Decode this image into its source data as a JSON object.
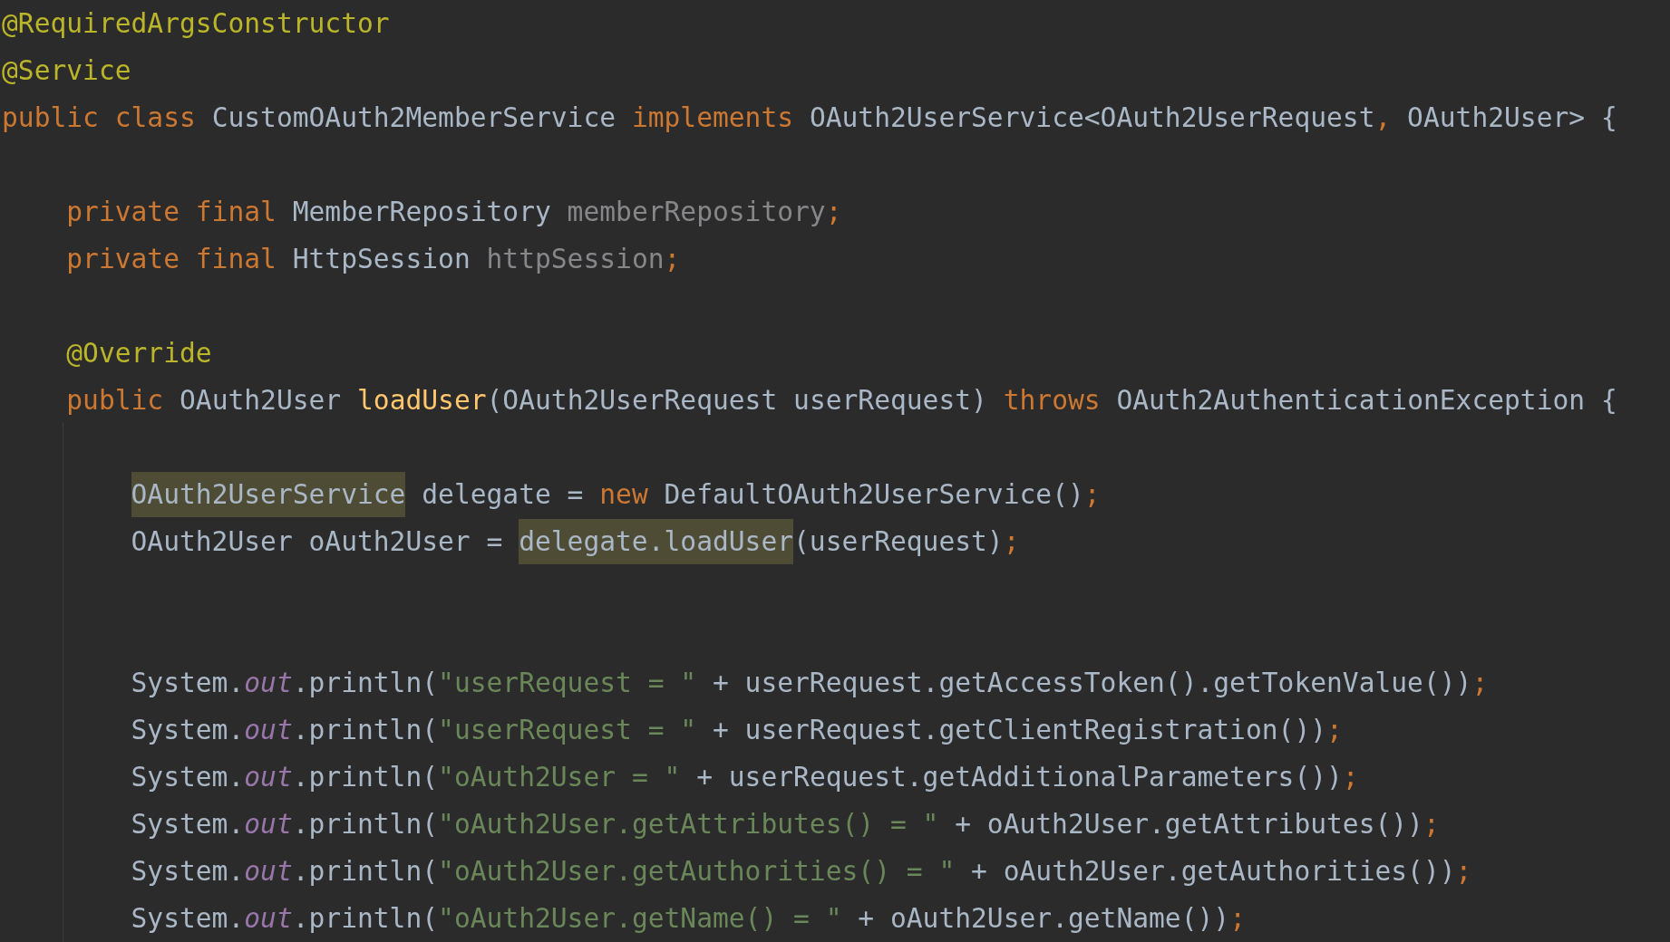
{
  "editor": {
    "lines": [
      {
        "kind": "code",
        "tokens": [
          {
            "text": "@RequiredArgsConstructor",
            "kind": "annotation"
          }
        ]
      },
      {
        "kind": "code",
        "tokens": [
          {
            "text": "@Service",
            "kind": "annotation"
          }
        ]
      },
      {
        "kind": "code",
        "tokens": [
          {
            "text": "public class ",
            "kind": "keyword"
          },
          {
            "text": "CustomOAuth2MemberService ",
            "kind": "plain"
          },
          {
            "text": "implements ",
            "kind": "keyword"
          },
          {
            "text": "OAuth2UserService<OAuth2UserRequest",
            "kind": "plain"
          },
          {
            "text": ",",
            "kind": "keyword"
          },
          {
            "text": " OAuth2User> {",
            "kind": "plain"
          }
        ]
      },
      {
        "kind": "blank"
      },
      {
        "kind": "code",
        "tokens": [
          {
            "text": "    private final ",
            "kind": "keyword"
          },
          {
            "text": "MemberRepository ",
            "kind": "plain"
          },
          {
            "text": "memberRepository",
            "kind": "field"
          },
          {
            "text": ";",
            "kind": "keyword"
          }
        ]
      },
      {
        "kind": "code",
        "tokens": [
          {
            "text": "    private final ",
            "kind": "keyword"
          },
          {
            "text": "HttpSession ",
            "kind": "plain"
          },
          {
            "text": "httpSession",
            "kind": "field"
          },
          {
            "text": ";",
            "kind": "keyword"
          }
        ]
      },
      {
        "kind": "blank"
      },
      {
        "kind": "code",
        "tokens": [
          {
            "text": "    @Override",
            "kind": "annotation"
          }
        ]
      },
      {
        "kind": "code",
        "tokens": [
          {
            "text": "    public ",
            "kind": "keyword"
          },
          {
            "text": "OAuth2User ",
            "kind": "plain"
          },
          {
            "text": "loadUser",
            "kind": "method"
          },
          {
            "text": "(OAuth2UserRequest userRequest) ",
            "kind": "plain"
          },
          {
            "text": "throws ",
            "kind": "keyword"
          },
          {
            "text": "OAuth2AuthenticationException {",
            "kind": "plain"
          }
        ]
      },
      {
        "kind": "blank"
      },
      {
        "kind": "code",
        "tokens": [
          {
            "text": "        OAuth2UserService",
            "kind": "highlight"
          },
          {
            "text": " delegate = ",
            "kind": "plain"
          },
          {
            "text": "new ",
            "kind": "keyword"
          },
          {
            "text": "DefaultOAuth2UserService()",
            "kind": "plain"
          },
          {
            "text": ";",
            "kind": "keyword"
          }
        ]
      },
      {
        "kind": "code",
        "tokens": [
          {
            "text": "        OAuth2User oAuth2User = ",
            "kind": "plain"
          },
          {
            "text": "delegate.loadUser",
            "kind": "highlight"
          },
          {
            "text": "(userRequest)",
            "kind": "plain"
          },
          {
            "text": ";",
            "kind": "keyword"
          }
        ]
      },
      {
        "kind": "blank"
      },
      {
        "kind": "blank"
      },
      {
        "kind": "code",
        "tokens": [
          {
            "text": "        System.",
            "kind": "plain"
          },
          {
            "text": "out",
            "kind": "static"
          },
          {
            "text": ".println(",
            "kind": "plain"
          },
          {
            "text": "\"userRequest = \"",
            "kind": "string"
          },
          {
            "text": " + userRequest.getAccessToken().getTokenValue())",
            "kind": "plain"
          },
          {
            "text": ";",
            "kind": "keyword"
          }
        ]
      },
      {
        "kind": "code",
        "tokens": [
          {
            "text": "        System.",
            "kind": "plain"
          },
          {
            "text": "out",
            "kind": "static"
          },
          {
            "text": ".println(",
            "kind": "plain"
          },
          {
            "text": "\"userRequest = \"",
            "kind": "string"
          },
          {
            "text": " + userRequest.getClientRegistration())",
            "kind": "plain"
          },
          {
            "text": ";",
            "kind": "keyword"
          }
        ]
      },
      {
        "kind": "code",
        "tokens": [
          {
            "text": "        System.",
            "kind": "plain"
          },
          {
            "text": "out",
            "kind": "static"
          },
          {
            "text": ".println(",
            "kind": "plain"
          },
          {
            "text": "\"oAuth2User = \"",
            "kind": "string"
          },
          {
            "text": " + userRequest.getAdditionalParameters())",
            "kind": "plain"
          },
          {
            "text": ";",
            "kind": "keyword"
          }
        ]
      },
      {
        "kind": "code",
        "tokens": [
          {
            "text": "        System.",
            "kind": "plain"
          },
          {
            "text": "out",
            "kind": "static"
          },
          {
            "text": ".println(",
            "kind": "plain"
          },
          {
            "text": "\"oAuth2User.getAttributes() = \"",
            "kind": "string"
          },
          {
            "text": " + oAuth2User.getAttributes())",
            "kind": "plain"
          },
          {
            "text": ";",
            "kind": "keyword"
          }
        ]
      },
      {
        "kind": "code",
        "tokens": [
          {
            "text": "        System.",
            "kind": "plain"
          },
          {
            "text": "out",
            "kind": "static"
          },
          {
            "text": ".println(",
            "kind": "plain"
          },
          {
            "text": "\"oAuth2User.getAuthorities() = \"",
            "kind": "string"
          },
          {
            "text": " + oAuth2User.getAuthorities())",
            "kind": "plain"
          },
          {
            "text": ";",
            "kind": "keyword"
          }
        ]
      },
      {
        "kind": "code",
        "tokens": [
          {
            "text": "        System.",
            "kind": "plain"
          },
          {
            "text": "out",
            "kind": "static"
          },
          {
            "text": ".println(",
            "kind": "plain"
          },
          {
            "text": "\"oAuth2User.getName() = \"",
            "kind": "string"
          },
          {
            "text": " + oAuth2User.getName())",
            "kind": "plain"
          },
          {
            "text": ";",
            "kind": "keyword"
          }
        ]
      }
    ]
  }
}
